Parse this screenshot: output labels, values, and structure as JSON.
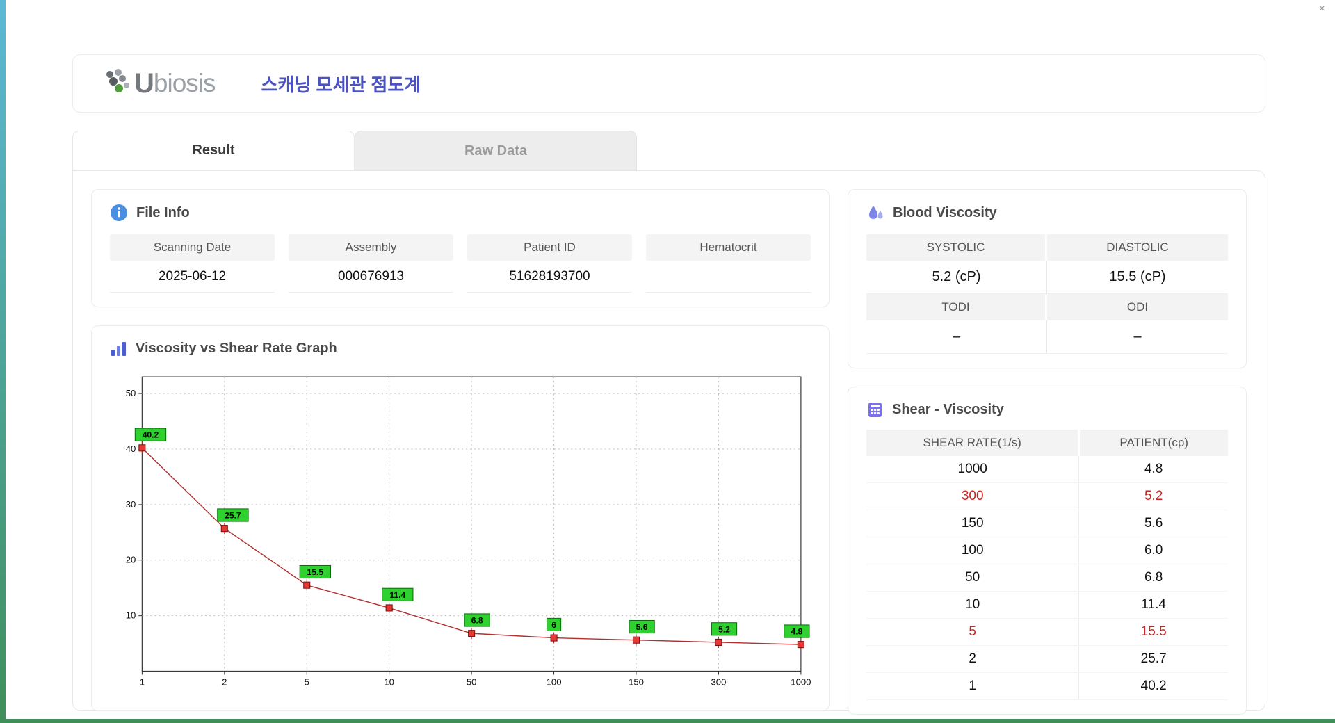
{
  "window": {
    "close": "×"
  },
  "header": {
    "brand_u": "U",
    "brand_rest": "biosis",
    "title": "스캐닝 모세관 점도계"
  },
  "tabs": {
    "result": "Result",
    "raw_data": "Raw Data"
  },
  "file_info": {
    "title": "File Info",
    "fields": [
      {
        "label": "Scanning Date",
        "value": "2025-06-12"
      },
      {
        "label": "Assembly",
        "value": "000676913"
      },
      {
        "label": "Patient ID",
        "value": "51628193700"
      },
      {
        "label": "Hematocrit",
        "value": ""
      }
    ]
  },
  "blood_viscosity": {
    "title": "Blood Viscosity",
    "systolic_label": "SYSTOLIC",
    "systolic_value": "5.2 (cP)",
    "diastolic_label": "DIASTOLIC",
    "diastolic_value": "15.5 (cP)",
    "todi_label": "TODI",
    "todi_value": "–",
    "odi_label": "ODI",
    "odi_value": "–"
  },
  "graph": {
    "title": "Viscosity vs Shear Rate Graph"
  },
  "chart_data": {
    "type": "line",
    "title": "Viscosity vs Shear Rate Graph",
    "xlabel": "",
    "ylabel": "",
    "xscale": "log-like categorical (evenly spaced ticks)",
    "x_ticks": [
      "1",
      "2",
      "5",
      "10",
      "50",
      "100",
      "150",
      "300",
      "1000"
    ],
    "x": [
      1,
      2,
      5,
      10,
      50,
      100,
      150,
      300,
      1000
    ],
    "values": [
      40.2,
      25.7,
      15.5,
      11.4,
      6.8,
      6,
      5.6,
      5.2,
      4.8
    ],
    "labels": [
      "40.2",
      "25.7",
      "15.5",
      "11.4",
      "6.8",
      "6",
      "5.6",
      "5.2",
      "4.8"
    ],
    "y_ticks": [
      10,
      20,
      30,
      40,
      50
    ],
    "ylim": [
      0,
      53
    ],
    "grid": true,
    "line_color": "#b03030",
    "marker_color": "#e53935",
    "marker_border": "#7a1010",
    "label_bg": "#2ed12e",
    "label_border": "#0b6b0b"
  },
  "shear_table": {
    "title": "Shear - Viscosity",
    "columns": [
      "SHEAR RATE(1/s)",
      "PATIENT(cp)"
    ],
    "rows": [
      {
        "shear": "1000",
        "patient": "4.8",
        "highlight": false
      },
      {
        "shear": "300",
        "patient": "5.2",
        "highlight": true
      },
      {
        "shear": "150",
        "patient": "5.6",
        "highlight": false
      },
      {
        "shear": "100",
        "patient": "6.0",
        "highlight": false
      },
      {
        "shear": "50",
        "patient": "6.8",
        "highlight": false
      },
      {
        "shear": "10",
        "patient": "11.4",
        "highlight": false
      },
      {
        "shear": "5",
        "patient": "15.5",
        "highlight": true
      },
      {
        "shear": "2",
        "patient": "25.7",
        "highlight": false
      },
      {
        "shear": "1",
        "patient": "40.2",
        "highlight": false
      }
    ]
  }
}
